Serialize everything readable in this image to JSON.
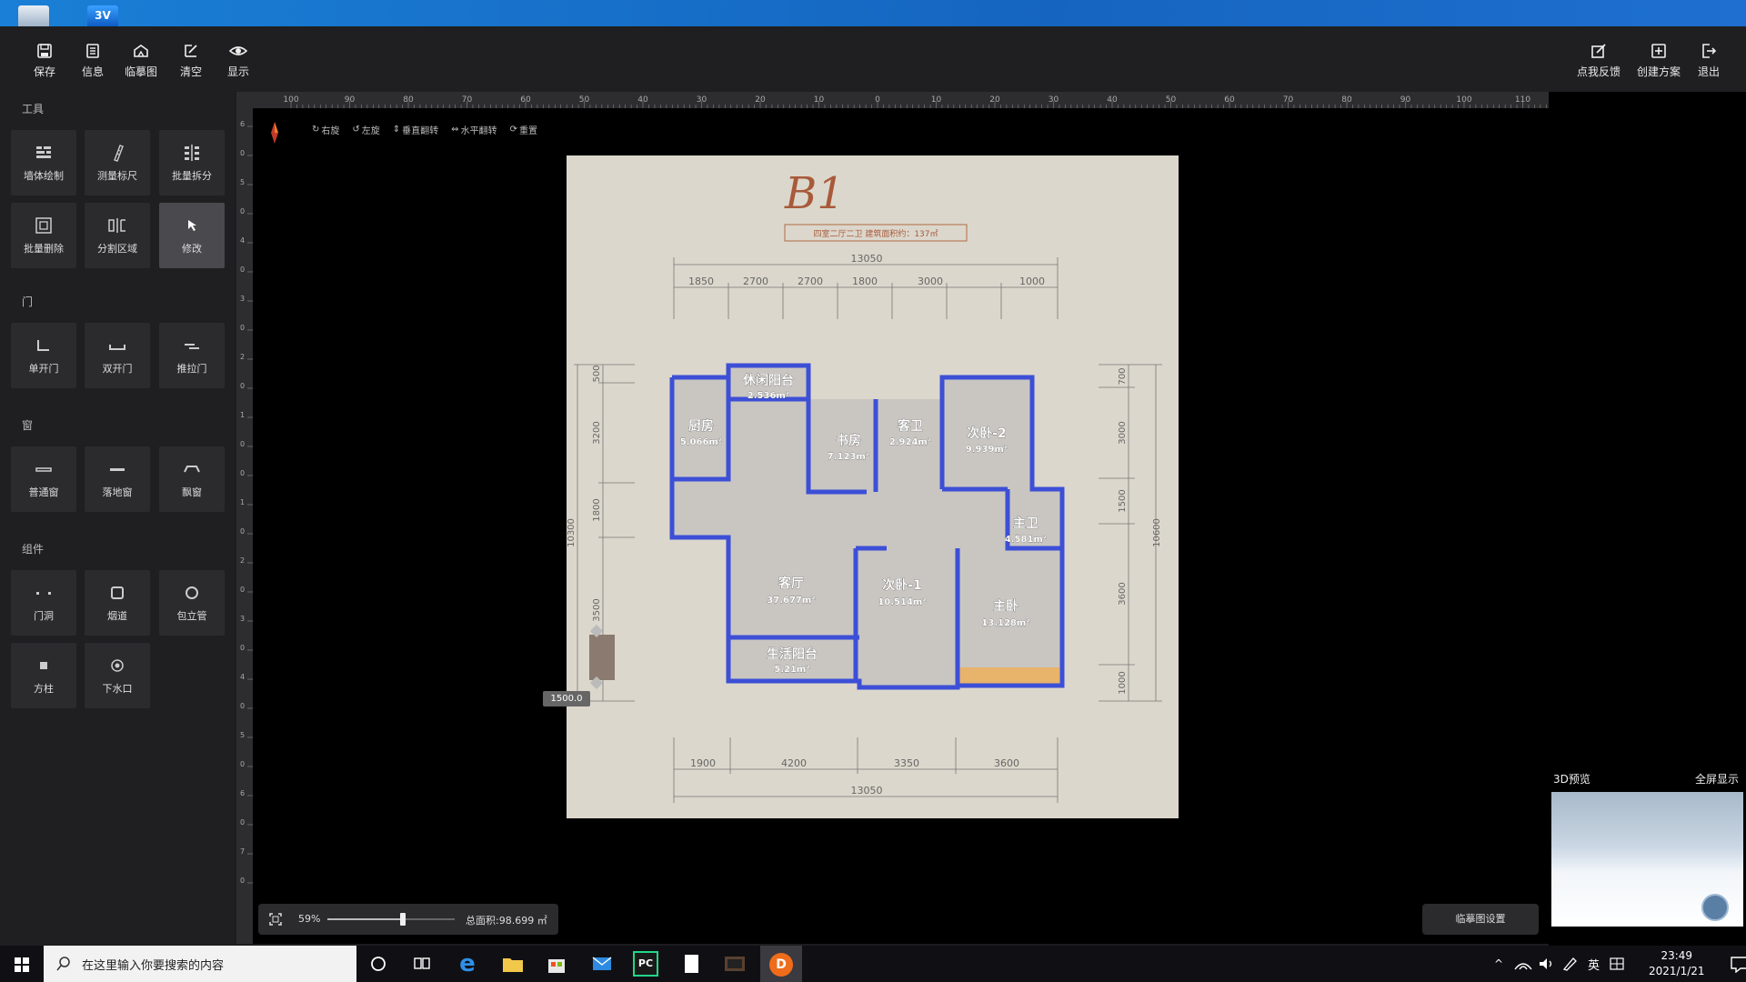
{
  "toolbar": {
    "left": [
      {
        "label": "保存",
        "icon": "save-icon"
      },
      {
        "label": "信息",
        "icon": "info-icon"
      },
      {
        "label": "临摹图",
        "icon": "trace-image-icon"
      },
      {
        "label": "清空",
        "icon": "clear-icon"
      },
      {
        "label": "显示",
        "icon": "eye-icon"
      }
    ],
    "right": [
      {
        "label": "点我反馈",
        "icon": "feedback-icon"
      },
      {
        "label": "创建方案",
        "icon": "create-plan-icon"
      },
      {
        "label": "退出",
        "icon": "exit-icon"
      }
    ]
  },
  "sections": {
    "tools": {
      "title": "工具",
      "items": [
        "墙体绘制",
        "测量标尺",
        "批量拆分",
        "批量删除",
        "分割区域",
        "修改"
      ]
    },
    "doors": {
      "title": "门",
      "items": [
        "单开门",
        "双开门",
        "推拉门"
      ]
    },
    "windows": {
      "title": "窗",
      "items": [
        "普通窗",
        "落地窗",
        "飘窗"
      ]
    },
    "components": {
      "title": "组件",
      "items": [
        "门洞",
        "烟道",
        "包立管",
        "方柱",
        "下水口"
      ]
    }
  },
  "ruler": {
    "h_labels": [
      "100",
      "90",
      "80",
      "70",
      "60",
      "50",
      "40",
      "30",
      "20",
      "10",
      "0",
      "10",
      "20",
      "30",
      "40",
      "50",
      "60",
      "70",
      "80",
      "90",
      "100",
      "110"
    ],
    "v_labels": [
      "6",
      "0",
      "5",
      "0",
      "4",
      "0",
      "3",
      "0",
      "2",
      "0",
      "1",
      "0",
      "0",
      "1",
      "0",
      "2",
      "0",
      "3",
      "0",
      "4",
      "0",
      "5",
      "0",
      "6",
      "0",
      "7",
      "0"
    ]
  },
  "edit_tools": [
    "右旋",
    "左旋",
    "垂直翻转",
    "水平翻转",
    "重置"
  ],
  "plan": {
    "title": "B1",
    "subtitle": "四室二厅二卫  建筑面积约：137㎡",
    "dim_top_total": "13050",
    "dim_top": [
      "1850",
      "2700",
      "2700",
      "1800",
      "3000",
      "1000"
    ],
    "dim_bottom": [
      "1900",
      "4200",
      "3350",
      "3600"
    ],
    "dim_bottom_total": "13050",
    "dim_left": [
      "500",
      "3200",
      "1800",
      "3500"
    ],
    "dim_left_total": "10300",
    "dim_right": [
      "700",
      "3000",
      "1500",
      "3600",
      "1000"
    ],
    "dim_right_total": "10600",
    "rooms": [
      {
        "name": "休闲阳台",
        "area": "2.536m²"
      },
      {
        "name": "厨房",
        "area": "5.066m²"
      },
      {
        "name": "书房",
        "area": "7.123m²"
      },
      {
        "name": "客卫",
        "area": "2.924m²"
      },
      {
        "name": "次卧-2",
        "area": "9.939m²"
      },
      {
        "name": "主卫",
        "area": "4.581m²"
      },
      {
        "name": "客厅",
        "area": "37.677m²"
      },
      {
        "name": "次卧-1",
        "area": "10.514m²"
      },
      {
        "name": "主卧",
        "area": "13.128m²"
      },
      {
        "name": "生活阳台",
        "area": "5.21m²"
      }
    ],
    "measure_label": "1500.0"
  },
  "zoom": {
    "percent": "59%",
    "level": 0.59,
    "total_area": "总面积:98.699 ㎡"
  },
  "settings_label": "临摹图设置",
  "preview": {
    "title": "3D预览",
    "fullscreen": "全屏显示"
  },
  "taskbar": {
    "search_placeholder": "在这里输入你要搜索的内容",
    "ime": "英",
    "time": "23:49",
    "date": "2021/1/21"
  },
  "colors": {
    "wall": "#3c4fd6",
    "paper": "#dcd7cc",
    "panel": "#1f1f21",
    "tile": "#2b2b2e"
  }
}
